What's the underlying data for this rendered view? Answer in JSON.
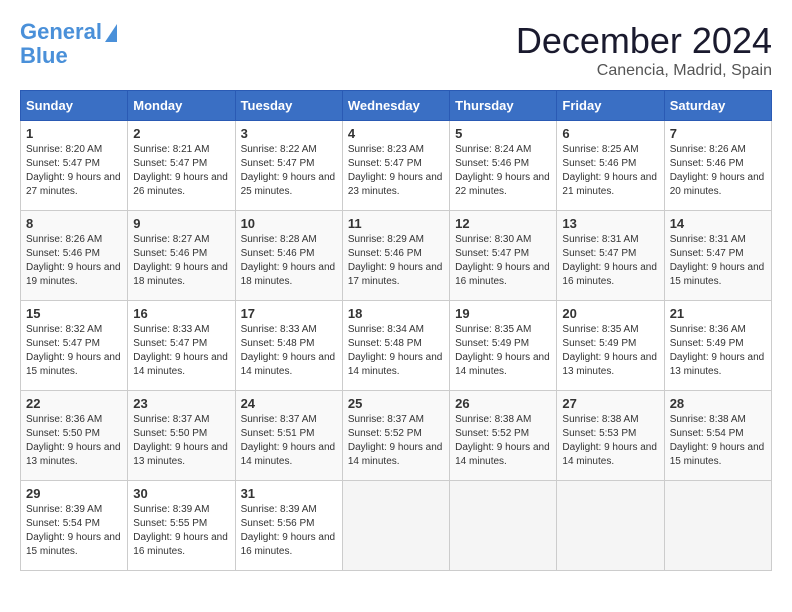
{
  "header": {
    "logo_line1": "General",
    "logo_line2": "Blue",
    "month": "December 2024",
    "location": "Canencia, Madrid, Spain"
  },
  "weekdays": [
    "Sunday",
    "Monday",
    "Tuesday",
    "Wednesday",
    "Thursday",
    "Friday",
    "Saturday"
  ],
  "weeks": [
    [
      {
        "day": "1",
        "sunrise": "8:20 AM",
        "sunset": "5:47 PM",
        "daylight": "9 hours and 27 minutes."
      },
      {
        "day": "2",
        "sunrise": "8:21 AM",
        "sunset": "5:47 PM",
        "daylight": "9 hours and 26 minutes."
      },
      {
        "day": "3",
        "sunrise": "8:22 AM",
        "sunset": "5:47 PM",
        "daylight": "9 hours and 25 minutes."
      },
      {
        "day": "4",
        "sunrise": "8:23 AM",
        "sunset": "5:47 PM",
        "daylight": "9 hours and 23 minutes."
      },
      {
        "day": "5",
        "sunrise": "8:24 AM",
        "sunset": "5:46 PM",
        "daylight": "9 hours and 22 minutes."
      },
      {
        "day": "6",
        "sunrise": "8:25 AM",
        "sunset": "5:46 PM",
        "daylight": "9 hours and 21 minutes."
      },
      {
        "day": "7",
        "sunrise": "8:26 AM",
        "sunset": "5:46 PM",
        "daylight": "9 hours and 20 minutes."
      }
    ],
    [
      {
        "day": "8",
        "sunrise": "8:26 AM",
        "sunset": "5:46 PM",
        "daylight": "9 hours and 19 minutes."
      },
      {
        "day": "9",
        "sunrise": "8:27 AM",
        "sunset": "5:46 PM",
        "daylight": "9 hours and 18 minutes."
      },
      {
        "day": "10",
        "sunrise": "8:28 AM",
        "sunset": "5:46 PM",
        "daylight": "9 hours and 18 minutes."
      },
      {
        "day": "11",
        "sunrise": "8:29 AM",
        "sunset": "5:46 PM",
        "daylight": "9 hours and 17 minutes."
      },
      {
        "day": "12",
        "sunrise": "8:30 AM",
        "sunset": "5:47 PM",
        "daylight": "9 hours and 16 minutes."
      },
      {
        "day": "13",
        "sunrise": "8:31 AM",
        "sunset": "5:47 PM",
        "daylight": "9 hours and 16 minutes."
      },
      {
        "day": "14",
        "sunrise": "8:31 AM",
        "sunset": "5:47 PM",
        "daylight": "9 hours and 15 minutes."
      }
    ],
    [
      {
        "day": "15",
        "sunrise": "8:32 AM",
        "sunset": "5:47 PM",
        "daylight": "9 hours and 15 minutes."
      },
      {
        "day": "16",
        "sunrise": "8:33 AM",
        "sunset": "5:47 PM",
        "daylight": "9 hours and 14 minutes."
      },
      {
        "day": "17",
        "sunrise": "8:33 AM",
        "sunset": "5:48 PM",
        "daylight": "9 hours and 14 minutes."
      },
      {
        "day": "18",
        "sunrise": "8:34 AM",
        "sunset": "5:48 PM",
        "daylight": "9 hours and 14 minutes."
      },
      {
        "day": "19",
        "sunrise": "8:35 AM",
        "sunset": "5:49 PM",
        "daylight": "9 hours and 14 minutes."
      },
      {
        "day": "20",
        "sunrise": "8:35 AM",
        "sunset": "5:49 PM",
        "daylight": "9 hours and 13 minutes."
      },
      {
        "day": "21",
        "sunrise": "8:36 AM",
        "sunset": "5:49 PM",
        "daylight": "9 hours and 13 minutes."
      }
    ],
    [
      {
        "day": "22",
        "sunrise": "8:36 AM",
        "sunset": "5:50 PM",
        "daylight": "9 hours and 13 minutes."
      },
      {
        "day": "23",
        "sunrise": "8:37 AM",
        "sunset": "5:50 PM",
        "daylight": "9 hours and 13 minutes."
      },
      {
        "day": "24",
        "sunrise": "8:37 AM",
        "sunset": "5:51 PM",
        "daylight": "9 hours and 14 minutes."
      },
      {
        "day": "25",
        "sunrise": "8:37 AM",
        "sunset": "5:52 PM",
        "daylight": "9 hours and 14 minutes."
      },
      {
        "day": "26",
        "sunrise": "8:38 AM",
        "sunset": "5:52 PM",
        "daylight": "9 hours and 14 minutes."
      },
      {
        "day": "27",
        "sunrise": "8:38 AM",
        "sunset": "5:53 PM",
        "daylight": "9 hours and 14 minutes."
      },
      {
        "day": "28",
        "sunrise": "8:38 AM",
        "sunset": "5:54 PM",
        "daylight": "9 hours and 15 minutes."
      }
    ],
    [
      {
        "day": "29",
        "sunrise": "8:39 AM",
        "sunset": "5:54 PM",
        "daylight": "9 hours and 15 minutes."
      },
      {
        "day": "30",
        "sunrise": "8:39 AM",
        "sunset": "5:55 PM",
        "daylight": "9 hours and 16 minutes."
      },
      {
        "day": "31",
        "sunrise": "8:39 AM",
        "sunset": "5:56 PM",
        "daylight": "9 hours and 16 minutes."
      },
      null,
      null,
      null,
      null
    ]
  ]
}
